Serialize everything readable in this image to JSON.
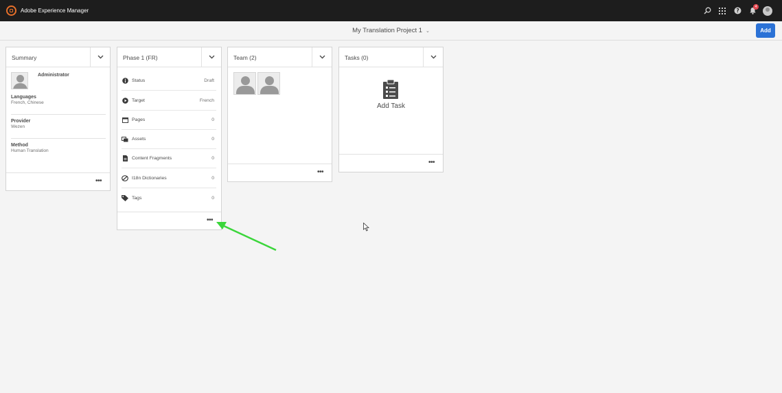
{
  "app": {
    "title": "Adobe Experience Manager",
    "notification_count": "4"
  },
  "header": {
    "project_title": "My Translation Project 1",
    "add_label": "Add"
  },
  "summary": {
    "title": "Summary",
    "admin": "Administrator",
    "fields": [
      {
        "label": "Languages",
        "value": "French, Chinese"
      },
      {
        "label": "Provider",
        "value": "Wezen"
      },
      {
        "label": "Method",
        "value": "Human Translation"
      }
    ]
  },
  "phase": {
    "title": "Phase 1 (FR)",
    "rows": [
      {
        "icon": "info-icon",
        "label": "Status",
        "value": "Draft"
      },
      {
        "icon": "play-circle-icon",
        "label": "Target",
        "value": "French"
      },
      {
        "icon": "pages-icon",
        "label": "Pages",
        "value": "0"
      },
      {
        "icon": "assets-icon",
        "label": "Assets",
        "value": "0"
      },
      {
        "icon": "document-icon",
        "label": "Content Fragments",
        "value": "0"
      },
      {
        "icon": "dictionary-icon",
        "label": "I18n Dictionaries",
        "value": "0"
      },
      {
        "icon": "tag-icon",
        "label": "Tags",
        "value": "0"
      }
    ]
  },
  "team": {
    "title": "Team (2)"
  },
  "tasks": {
    "title": "Tasks (0)",
    "add_task": "Add Task"
  },
  "colors": {
    "topbar": "#1d1d1d",
    "accent": "#2b72d6",
    "brand": "#e8702a",
    "arrow": "#3bd63b"
  }
}
